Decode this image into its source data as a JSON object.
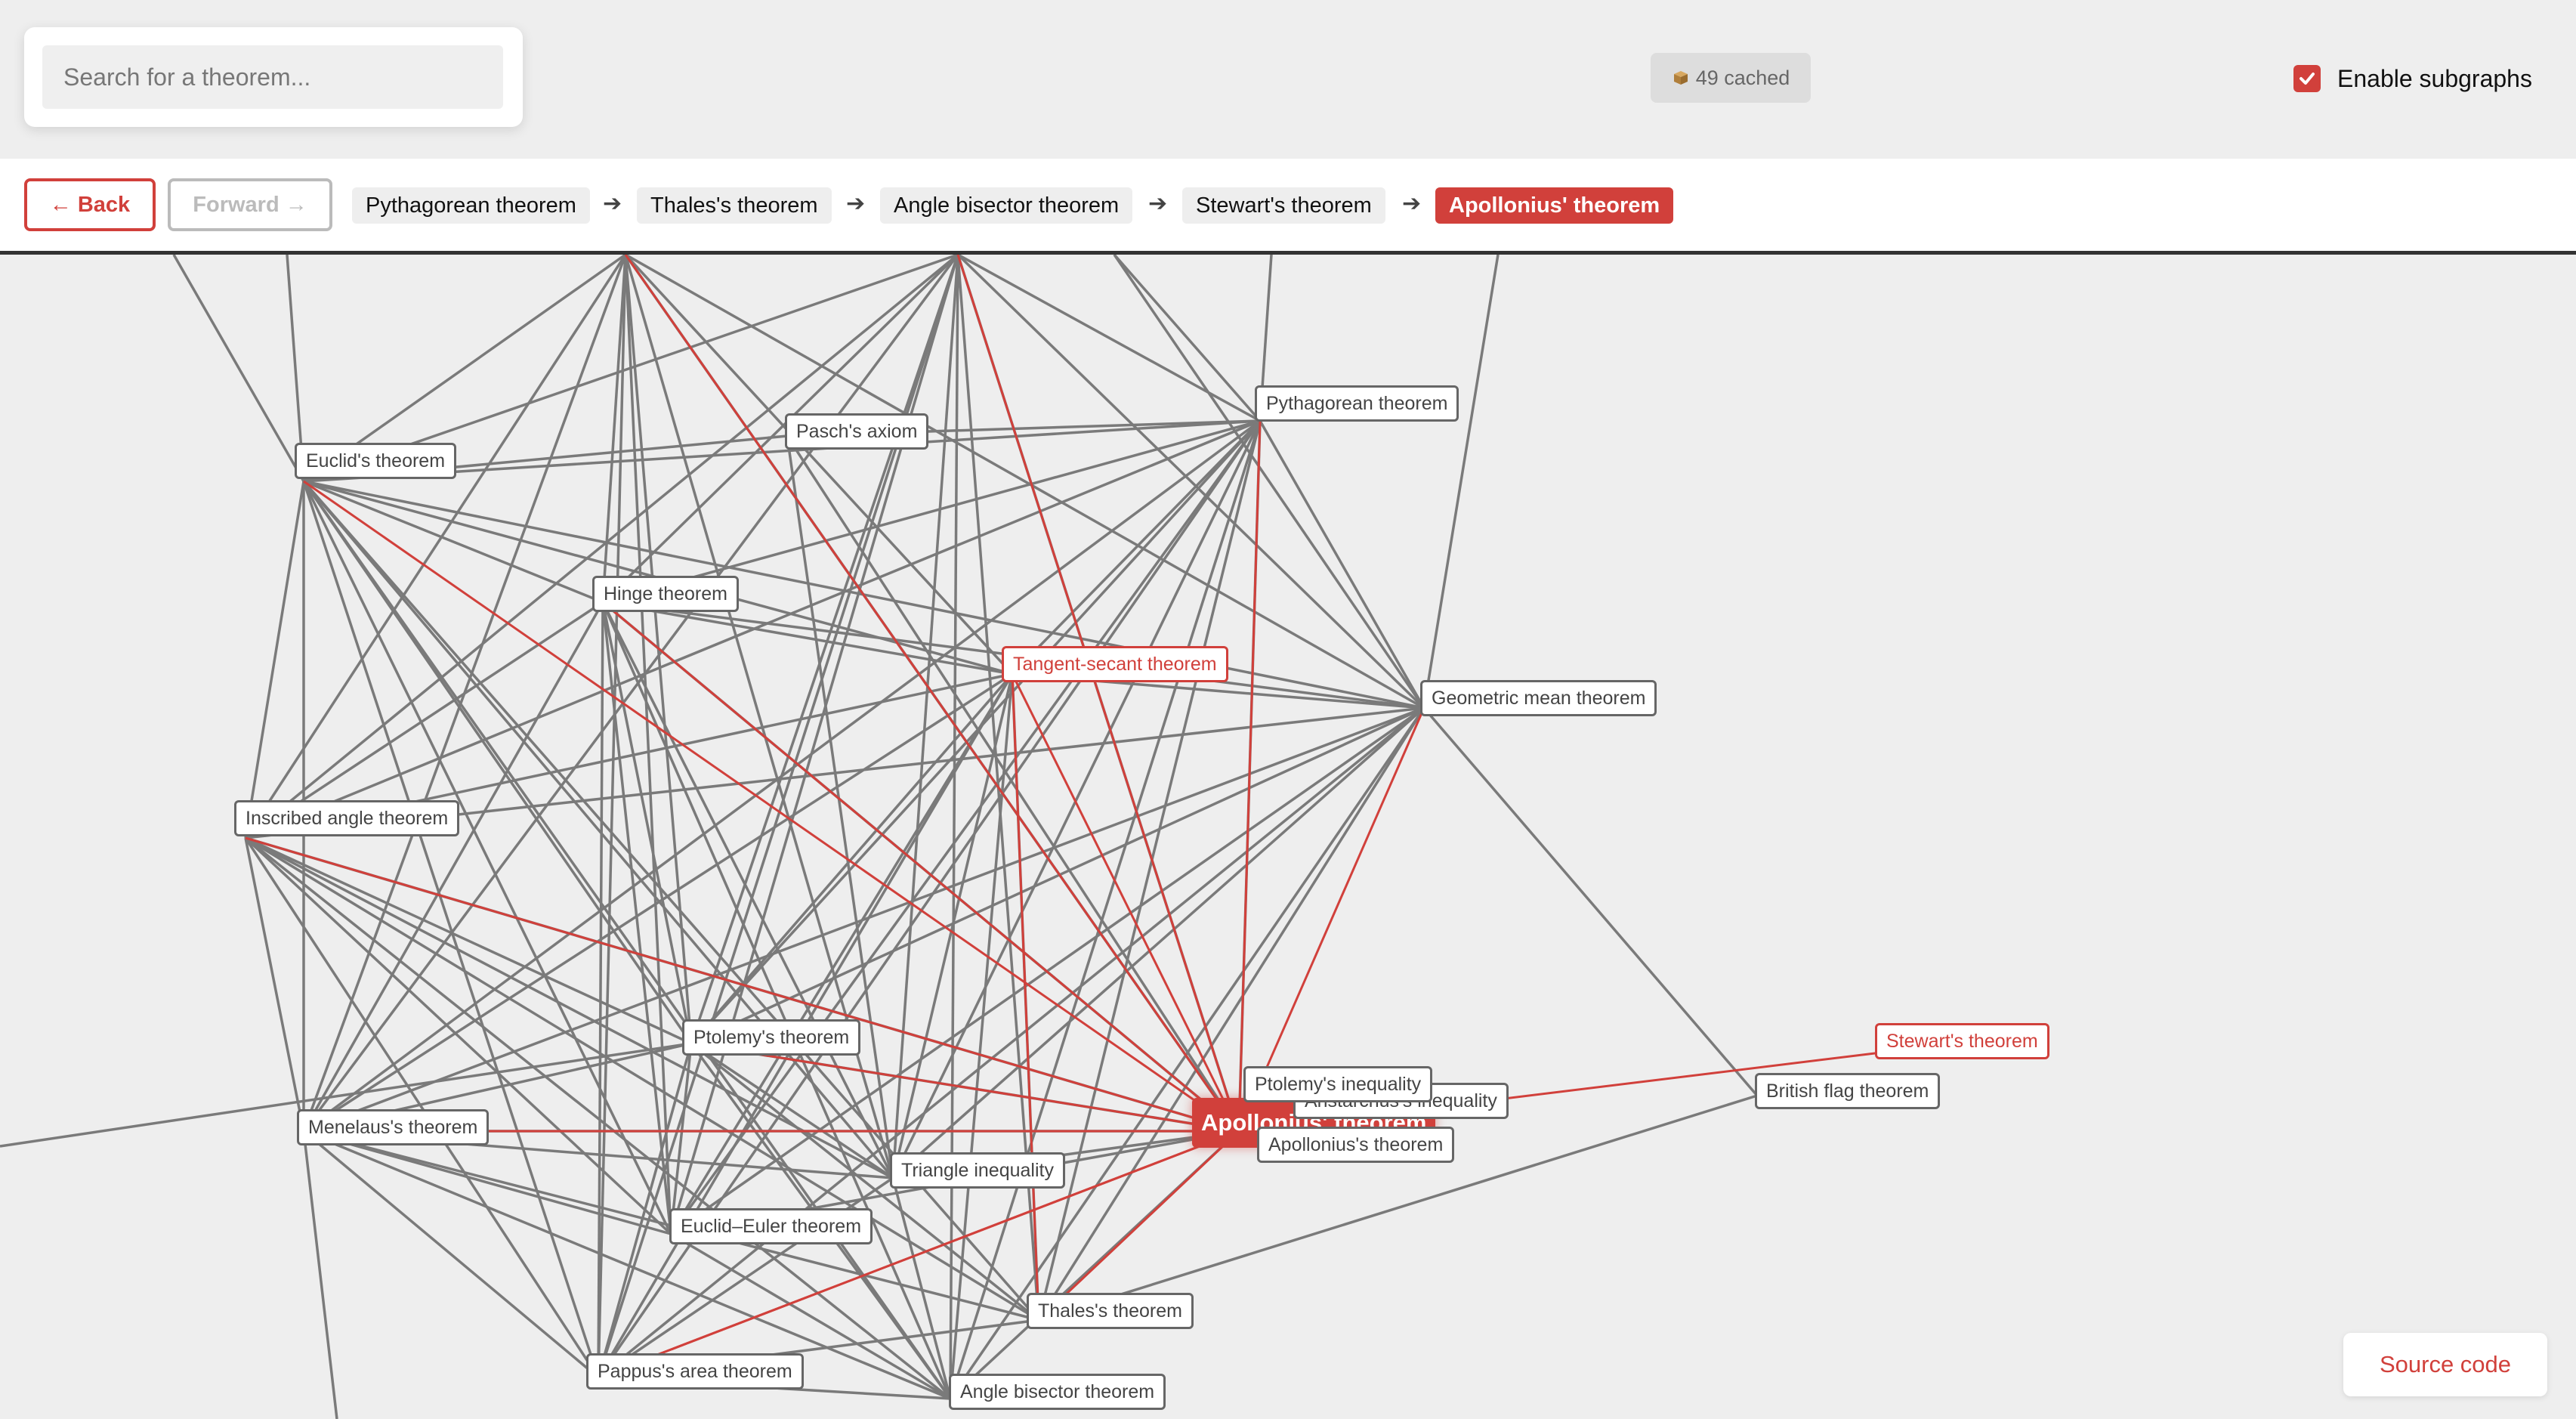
{
  "search": {
    "placeholder": "Search for a theorem..."
  },
  "cache": {
    "label": "49 cached",
    "icon": "package-icon"
  },
  "subgraphs": {
    "label": "Enable subgraphs",
    "checked": true
  },
  "nav": {
    "back": "← Back",
    "forward": "Forward →",
    "breadcrumbs": [
      "Pythagorean theorem",
      "Thales's theorem",
      "Angle bisector theorem",
      "Stewart's theorem",
      "Apollonius' theorem"
    ],
    "arrow": "➔"
  },
  "graph": {
    "nodes": {
      "pythagorean": "Pythagorean theorem",
      "pasch": "Pasch's axiom",
      "euclid": "Euclid's theorem",
      "hinge": "Hinge theorem",
      "tangent_secant": "Tangent-secant theorem",
      "geometric_mean": "Geometric mean theorem",
      "inscribed_angle": "Inscribed angle theorem",
      "stewart": "Stewart's theorem",
      "british_flag": "British flag theorem",
      "ptolemy": "Ptolemy's theorem",
      "ptolemy_inequality": "Ptolemy's inequality",
      "aristarchus": "Aristarchus's inequality",
      "menelaus": "Menelaus's theorem",
      "apollonius_main": "Apollonius' theorem",
      "apollonius": "Apollonius's theorem",
      "triangle_inequality": "Triangle inequality",
      "euclid_euler": "Euclid–Euler theorem",
      "thales": "Thales's theorem",
      "pappus": "Pappus's area theorem",
      "angle_bisector": "Angle bisector theorem"
    },
    "colors": {
      "edge": "#7a7a7a",
      "highlight": "#d1403b"
    }
  },
  "footer": {
    "source": "Source code"
  }
}
